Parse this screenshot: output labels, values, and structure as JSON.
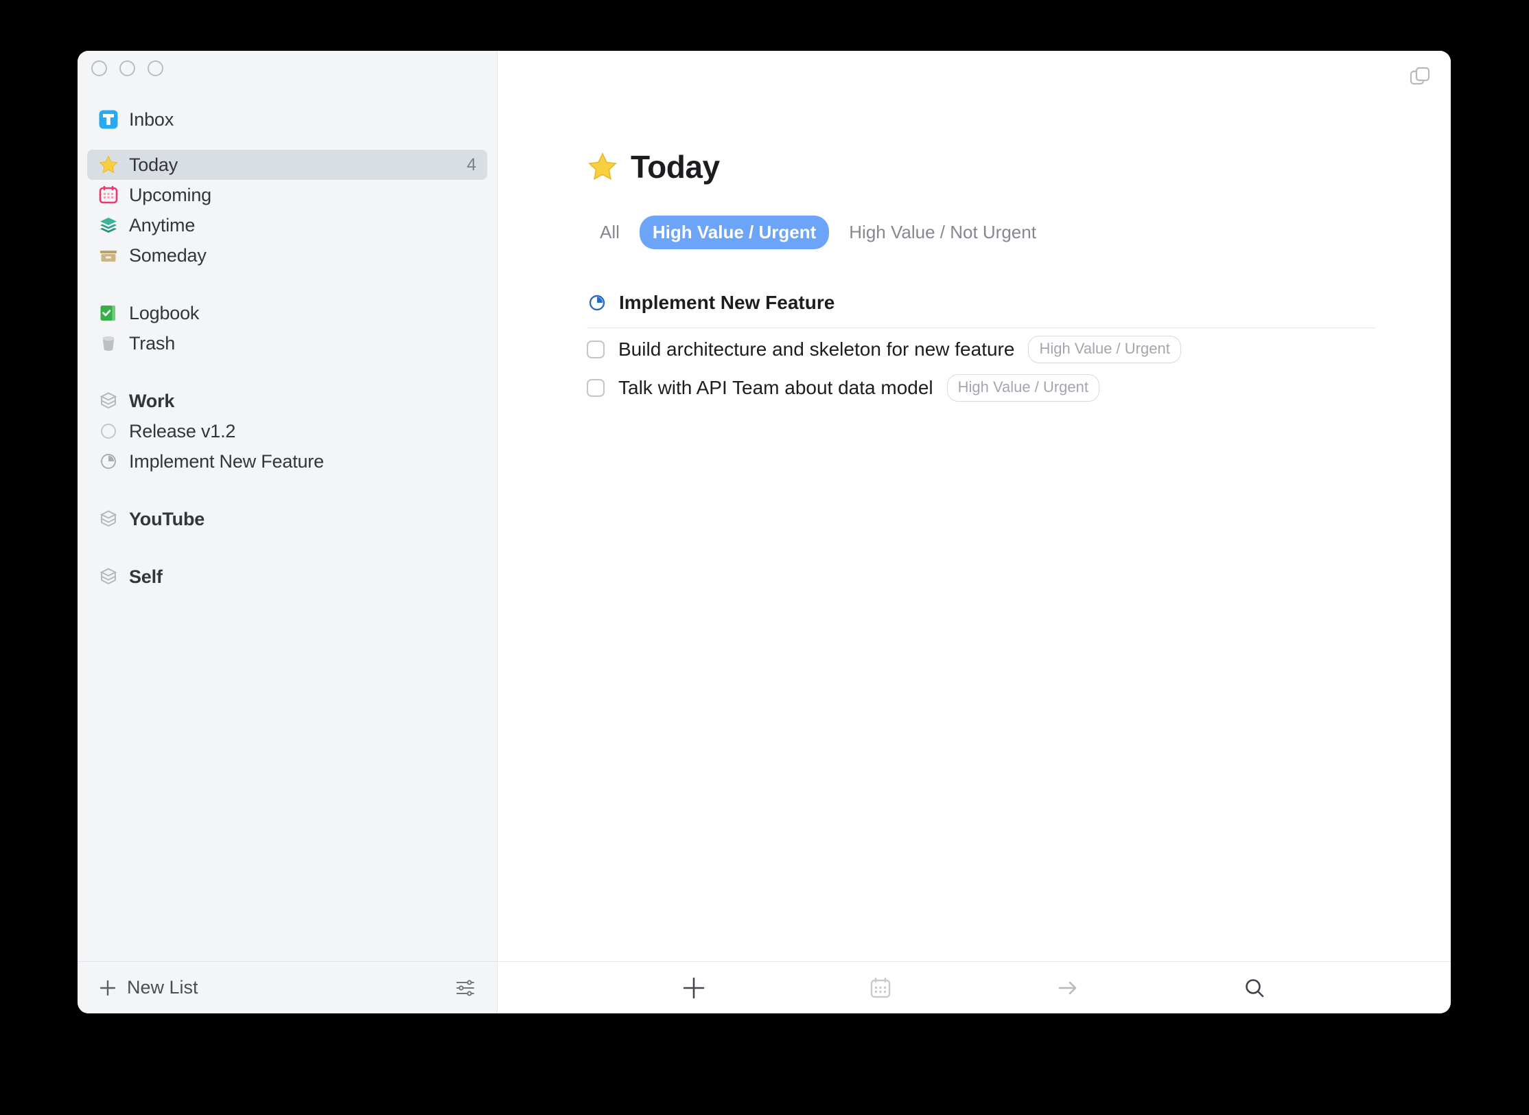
{
  "window": {
    "traffic_lights": [
      "close",
      "minimize",
      "zoom"
    ],
    "new_window_icon": "duplicate-window-icon"
  },
  "sidebar": {
    "items": [
      {
        "id": "inbox",
        "label": "Inbox",
        "icon": "inbox-icon",
        "bold": false,
        "selected": false,
        "badge": ""
      },
      {
        "id": "today",
        "label": "Today",
        "icon": "star-icon",
        "bold": false,
        "selected": true,
        "badge": "4"
      },
      {
        "id": "upcoming",
        "label": "Upcoming",
        "icon": "calendar-icon",
        "bold": false,
        "selected": false,
        "badge": ""
      },
      {
        "id": "anytime",
        "label": "Anytime",
        "icon": "layers-icon",
        "bold": false,
        "selected": false,
        "badge": ""
      },
      {
        "id": "someday",
        "label": "Someday",
        "icon": "archive-box-icon",
        "bold": false,
        "selected": false,
        "badge": ""
      },
      {
        "id": "logbook",
        "label": "Logbook",
        "icon": "logbook-icon",
        "bold": false,
        "selected": false,
        "badge": ""
      },
      {
        "id": "trash",
        "label": "Trash",
        "icon": "trash-icon",
        "bold": false,
        "selected": false,
        "badge": ""
      },
      {
        "id": "work",
        "label": "Work",
        "icon": "area-icon",
        "bold": true,
        "selected": false,
        "badge": ""
      },
      {
        "id": "release-v12",
        "label": "Release v1.2",
        "icon": "project-circle-empty-icon",
        "bold": false,
        "selected": false,
        "badge": ""
      },
      {
        "id": "implement-new-feature",
        "label": "Implement New Feature",
        "icon": "project-circle-progress-icon",
        "bold": false,
        "selected": false,
        "badge": ""
      },
      {
        "id": "youtube",
        "label": "YouTube",
        "icon": "area-icon",
        "bold": true,
        "selected": false,
        "badge": ""
      },
      {
        "id": "self",
        "label": "Self",
        "icon": "area-icon",
        "bold": true,
        "selected": false,
        "badge": ""
      }
    ],
    "footer": {
      "new_list_label": "New List",
      "new_list_icon": "plus-icon",
      "settings_icon": "sliders-icon"
    }
  },
  "main": {
    "title": "Today",
    "title_icon": "star-icon",
    "filters": [
      {
        "label": "All",
        "active": false
      },
      {
        "label": "High Value / Urgent",
        "active": true
      },
      {
        "label": "High Value / Not Urgent",
        "active": false
      }
    ],
    "group": {
      "title": "Implement New Feature",
      "icon": "project-circle-progress-icon",
      "tasks": [
        {
          "title": "Build architecture and skeleton for new feature",
          "tag": "High Value / Urgent",
          "checked": false
        },
        {
          "title": "Talk with API Team about data model",
          "tag": "High Value / Urgent",
          "checked": false
        }
      ]
    },
    "toolbar": [
      {
        "id": "new-todo",
        "icon": "plus-icon",
        "state": "enabled"
      },
      {
        "id": "when",
        "icon": "calendar-icon",
        "state": "disabled"
      },
      {
        "id": "move",
        "icon": "arrow-right-icon",
        "state": "disabled"
      },
      {
        "id": "search",
        "icon": "search-icon",
        "state": "enabled"
      }
    ]
  },
  "colors": {
    "accent_blue": "#6ba4f8",
    "project_blue": "#2a6ac4",
    "inbox_blue": "#29a9f2",
    "star_yellow": "#f8cf3f",
    "calendar_pink": "#f0376c",
    "anytime_teal": "#2fa08a",
    "someday_tan": "#c3ab74",
    "logbook_green": "#37b04a",
    "trash_gray": "#bcc0c5",
    "selection_gray": "#d9dee2",
    "sidebar_bg": "#f4f5f7"
  }
}
